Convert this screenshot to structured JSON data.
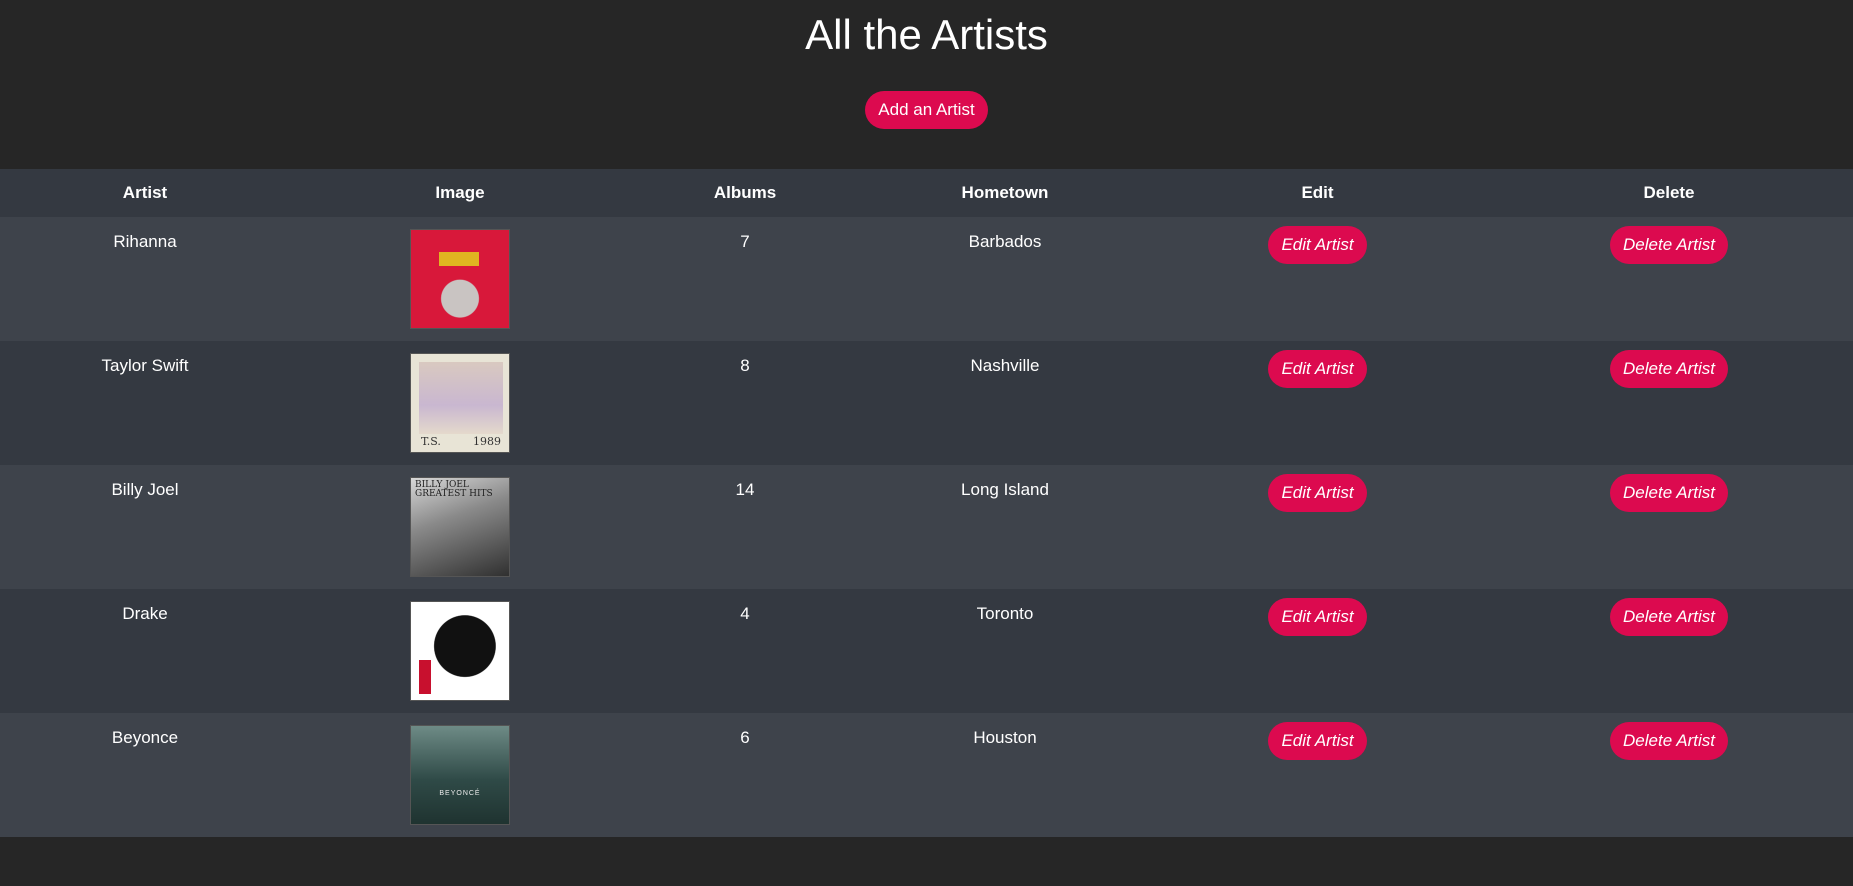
{
  "header": {
    "title": "All the Artists",
    "add_button_label": "Add an Artist"
  },
  "table": {
    "columns": [
      "Artist",
      "Image",
      "Albums",
      "Hometown",
      "Edit",
      "Delete"
    ],
    "rows": [
      {
        "artist": "Rihanna",
        "image": "rihanna-album-cover",
        "albums": "7",
        "hometown": "Barbados",
        "edit_label": "Edit Artist",
        "delete_label": "Delete Artist"
      },
      {
        "artist": "Taylor Swift",
        "image": "taylor-swift-1989-cover",
        "image_caption_left": "T.S.",
        "image_caption_right": "1989",
        "albums": "8",
        "hometown": "Nashville",
        "edit_label": "Edit Artist",
        "delete_label": "Delete Artist"
      },
      {
        "artist": "Billy Joel",
        "image": "billy-joel-greatest-hits-cover",
        "image_caption": "BILLY JOEL GREATEST HITS",
        "albums": "14",
        "hometown": "Long Island",
        "edit_label": "Edit Artist",
        "delete_label": "Delete Artist"
      },
      {
        "artist": "Drake",
        "image": "drake-take-care-cover",
        "albums": "4",
        "hometown": "Toronto",
        "edit_label": "Edit Artist",
        "delete_label": "Delete Artist"
      },
      {
        "artist": "Beyonce",
        "image": "beyonce-album-cover",
        "image_caption": "BEYONCÉ",
        "albums": "6",
        "hometown": "Houston",
        "edit_label": "Edit Artist",
        "delete_label": "Delete Artist"
      }
    ]
  },
  "colors": {
    "background": "#262626",
    "row_odd": "#3e434b",
    "row_even": "#343941",
    "accent": "#dc0a4f"
  }
}
